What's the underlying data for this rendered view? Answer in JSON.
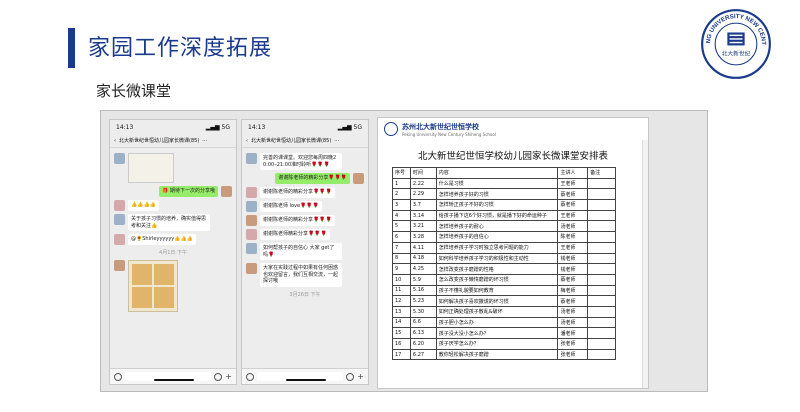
{
  "slide": {
    "title": "家园工作深度拓展",
    "subtitle": "家长微课堂"
  },
  "logo": {
    "arc_text": "PEKING UNIVERSITY NEW CENTURY",
    "center_text": "北大新世纪",
    "brand_color": "#1a3a8c"
  },
  "phone1": {
    "time": "14:13",
    "signal": "▂▄▆ 5G",
    "chat_title": "北大新世纪世恒幼儿园家长微课(85)",
    "messages": [
      {
        "side": "right",
        "text": "🎁 期待下一次的分享哦",
        "style": "green"
      },
      {
        "side": "left",
        "text": "👍👍👍👍"
      },
      {
        "side": "left",
        "text": "关于孩子习惯的培养，确实值得思考和关注👍"
      },
      {
        "side": "left",
        "text": "@🌻Shirleyyyyyy👍👍👍"
      }
    ],
    "timestamp": "4月1日 下午"
  },
  "phone2": {
    "time": "14:13",
    "signal": "▂▄▆ 5G",
    "chat_title": "北大新世纪世恒幼儿园家长微课(85)",
    "messages": [
      {
        "side": "left",
        "text": "完善的课课堂。欢迎您每周四晚20:00–21:00准时聆听🌹🌹🌹"
      },
      {
        "side": "right",
        "text": "谢谢陈老师的精彩分享🌹🌹🌹",
        "style": "green"
      },
      {
        "side": "left",
        "text": "谢谢陈老师的精彩分享🌹🌹🌹"
      },
      {
        "side": "left",
        "text": "谢谢陈老师 love🌹🌹🌹"
      },
      {
        "side": "left",
        "text": "谢谢陈老师的精彩分享🌹🌹🌹"
      },
      {
        "side": "left",
        "text": "谢谢陈老师精彩分享🌹🌹🌹"
      },
      {
        "side": "left",
        "text": "如何帮孩子的自信心 大家 get了吗🌹"
      },
      {
        "side": "left",
        "text": "大家在实践过程中如果有任何困惑也欢迎留言，我们互相交流，一起探讨哦"
      }
    ],
    "timestamp": "3月26日 下午"
  },
  "document": {
    "school_name": "苏州北大新世纪世恒学校",
    "school_name_en": "Peking University New Century Shiheng School",
    "title": "北大新世纪世恒学校幼儿园家长微课堂安排表",
    "columns": [
      "序号",
      "时间",
      "内容",
      "主讲人",
      "备注"
    ],
    "rows": [
      [
        "1",
        "2.22",
        "什么是习惯",
        "王老师",
        ""
      ],
      [
        "2",
        "2.29",
        "怎样培养孩子好的习惯",
        "蔡老师",
        ""
      ],
      [
        "3",
        "3.7",
        "怎样矫正孩子不好的习惯",
        "蔡老师",
        ""
      ],
      [
        "4",
        "3.14",
        "给孩子播下这6个好习惯，就是播下好的命运种子",
        "王老师",
        ""
      ],
      [
        "5",
        "3.21",
        "怎样培养孩子的耐心",
        "汤老师",
        ""
      ],
      [
        "6",
        "3.28",
        "怎样培养孩子的自信心",
        "陈老师",
        ""
      ],
      [
        "7",
        "4.11",
        "怎样培养孩子学习时独立思考问题的能力",
        "王老师",
        ""
      ],
      [
        "8",
        "4.18",
        "如何科学培养孩子学习的积极性和主动性",
        "钱老师",
        ""
      ],
      [
        "9",
        "4.25",
        "怎样改变孩子磨蹭的性格",
        "钱老师",
        ""
      ],
      [
        "10",
        "5.9",
        "怎么改变孩子懒惰磨蹭的坏习惯",
        "蔡老师",
        ""
      ],
      [
        "11",
        "5.16",
        "孩子不懂礼貌要如何教育",
        "梅老师",
        ""
      ],
      [
        "12",
        "5.23",
        "如何解决孩子喜欢撒谎的坏习惯",
        "蔡老师",
        ""
      ],
      [
        "13",
        "5.30",
        "如何正确处理孩子散乱&破坏",
        "汤老师",
        ""
      ],
      [
        "14",
        "6.6",
        "孩子胆小怎么办",
        "汤老师",
        ""
      ],
      [
        "15",
        "6.13",
        "孩子没大没小怎么办？",
        "潘老师",
        ""
      ],
      [
        "16",
        "6.20",
        "孩子厌学怎么办？",
        "张老师",
        ""
      ],
      [
        "17",
        "6.27",
        "教你轻松解决孩子磨蹭",
        "张老师",
        ""
      ]
    ]
  }
}
